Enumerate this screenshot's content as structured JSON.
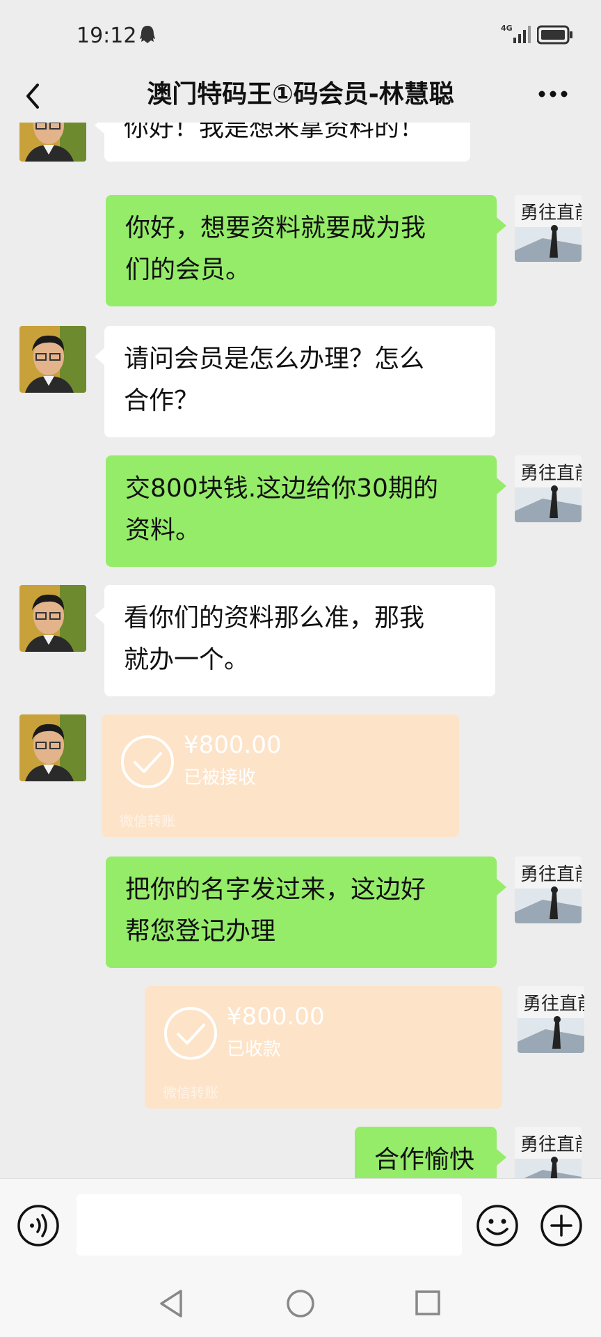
{
  "status_bar": {
    "time": "19:12",
    "network": "4G",
    "icons": [
      "qq-ghost-icon",
      "signal-icon",
      "battery-icon"
    ]
  },
  "nav": {
    "title": "澳门特码王①码会员-林慧聪",
    "back_icon": "chevron-left-icon",
    "more_icon": "more-dots-icon"
  },
  "messages": [
    {
      "side": "left",
      "type": "text",
      "text": "你好！我是想来拿资料的！"
    },
    {
      "side": "right",
      "type": "text",
      "lines": [
        "你好，想要资料就要成为我",
        "们的会员。"
      ]
    },
    {
      "side": "left",
      "type": "text",
      "lines": [
        "请问会员是怎么办理？怎么",
        "合作？"
      ]
    },
    {
      "side": "right",
      "type": "text",
      "lines": [
        "交800块钱.这边给你30期的",
        "资料。"
      ]
    },
    {
      "side": "left",
      "type": "text",
      "lines": [
        "看你们的资料那么准，那我",
        "就办一个。"
      ]
    },
    {
      "side": "left",
      "type": "transfer",
      "amount": "¥800.00",
      "status": "已被接收",
      "footer": "微信转账"
    },
    {
      "side": "right",
      "type": "text",
      "lines": [
        "把你的名字发过来，这边好",
        "帮您登记办理"
      ]
    },
    {
      "side": "right",
      "type": "transfer",
      "amount": "¥800.00",
      "status": "已收款",
      "footer": "微信转账"
    },
    {
      "side": "right",
      "type": "text",
      "text": "合作愉快"
    }
  ],
  "colors": {
    "background": "#ededed",
    "bubble_self": "#95ec69",
    "bubble_other": "#ffffff",
    "transfer": "#fde3c8"
  },
  "input_bar": {
    "voice_icon": "voice-icon",
    "emoji_icon": "emoji-icon",
    "plus_icon": "plus-icon"
  },
  "system_nav": [
    "back-triangle-icon",
    "home-circle-icon",
    "recents-square-icon"
  ]
}
